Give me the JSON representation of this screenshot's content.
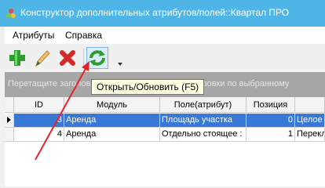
{
  "window": {
    "title": "Конструктор дополнительных атрибутов/полей::Квартал ПРО"
  },
  "menu": {
    "items": [
      "Атрибуты",
      "Справка"
    ]
  },
  "toolbar": {
    "buttons": [
      {
        "icon": "plus-icon",
        "color": "#2e9e2e"
      },
      {
        "icon": "pencil-icon",
        "color": "#e6a23c"
      },
      {
        "icon": "delete-x-icon",
        "color": "#d42a2a"
      },
      {
        "icon": "refresh-icon",
        "color": "#2e9e2e"
      }
    ],
    "tooltip": "Открыть/Обновить (F5)"
  },
  "group_panel": {
    "hint": "Перетащите заголовок колонки сюда для группировки по выбранному"
  },
  "grid": {
    "columns": [
      "ID",
      "Модуль",
      "Поле(атрибут)",
      "Позиция",
      ""
    ],
    "rows": [
      {
        "id": "3",
        "module": "Аренда",
        "field": "Площадь участка",
        "position": "0",
        "extra": "Целое ч",
        "selected": true
      },
      {
        "id": "4",
        "module": "Аренда",
        "field": "Отдельно стоящее :",
        "position": "1",
        "extra": "Перекл",
        "selected": false
      }
    ]
  },
  "colors": {
    "titlebar": "#4fb5e6",
    "selection": "#3a78d6",
    "annotation_arrow": "#e0262a"
  }
}
